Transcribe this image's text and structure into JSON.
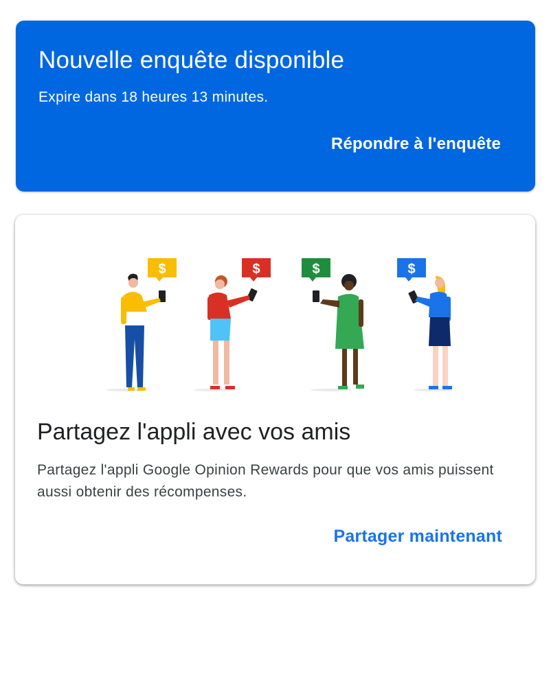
{
  "survey_card": {
    "title": "Nouvelle enquête disponible",
    "expiry": "Expire dans 18 heures 13 minutes.",
    "action_label": "Répondre à l'enquête",
    "background_color": "#0167e0"
  },
  "share_card": {
    "illustration_icon": "people-sharing-rewards-illustration",
    "bubble_symbol": "$",
    "title": "Partagez l'appli avec vos amis",
    "description": "Partagez l'appli Google Opinion Rewards pour que vos amis puissent aussi obtenir des récompenses.",
    "action_label": "Partager maintenant",
    "action_color": "#1a73e8"
  }
}
